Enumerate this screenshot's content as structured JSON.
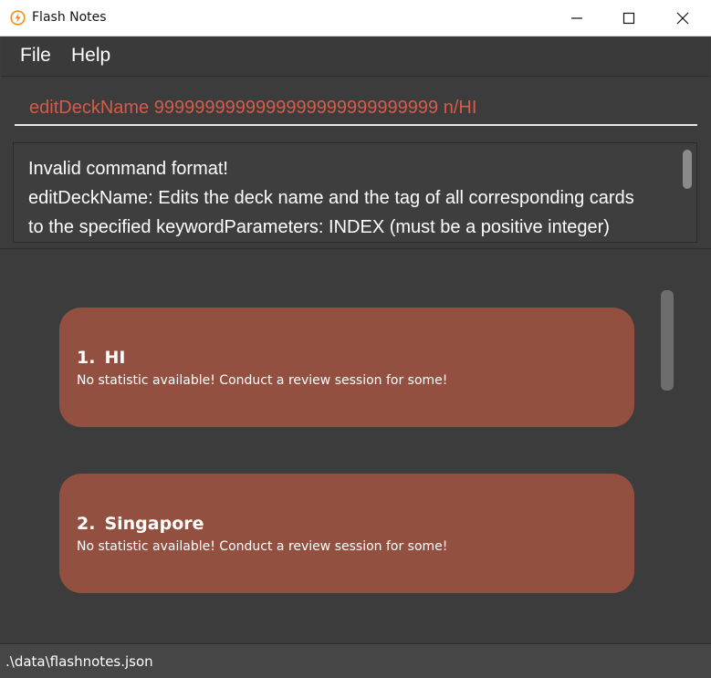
{
  "window": {
    "title": "Flash Notes"
  },
  "menu": {
    "file": "File",
    "help": "Help"
  },
  "command": {
    "value": "editDeckName 9999999999999999999999999999 n/HI"
  },
  "result": {
    "lines": [
      "Invalid command format!",
      "editDeckName: Edits the deck name and the tag of all corresponding cards",
      "to the specified keywordParameters: INDEX (must be a positive integer)"
    ]
  },
  "decks": [
    {
      "index": "1.",
      "name": "HI",
      "stats": "No statistic available! Conduct a review session for some!"
    },
    {
      "index": "2.",
      "name": "Singapore",
      "stats": "No statistic available! Conduct a review session for some!"
    }
  ],
  "status": {
    "path": ".\\data\\flashnotes.json"
  },
  "colors": {
    "command_text": "#d75b48",
    "deck_card": "#934f3f",
    "app_icon": "#f08c1a"
  },
  "icons": {
    "app": "lightning-icon",
    "minimize": "minimize-icon",
    "maximize": "maximize-icon",
    "close": "close-icon"
  }
}
